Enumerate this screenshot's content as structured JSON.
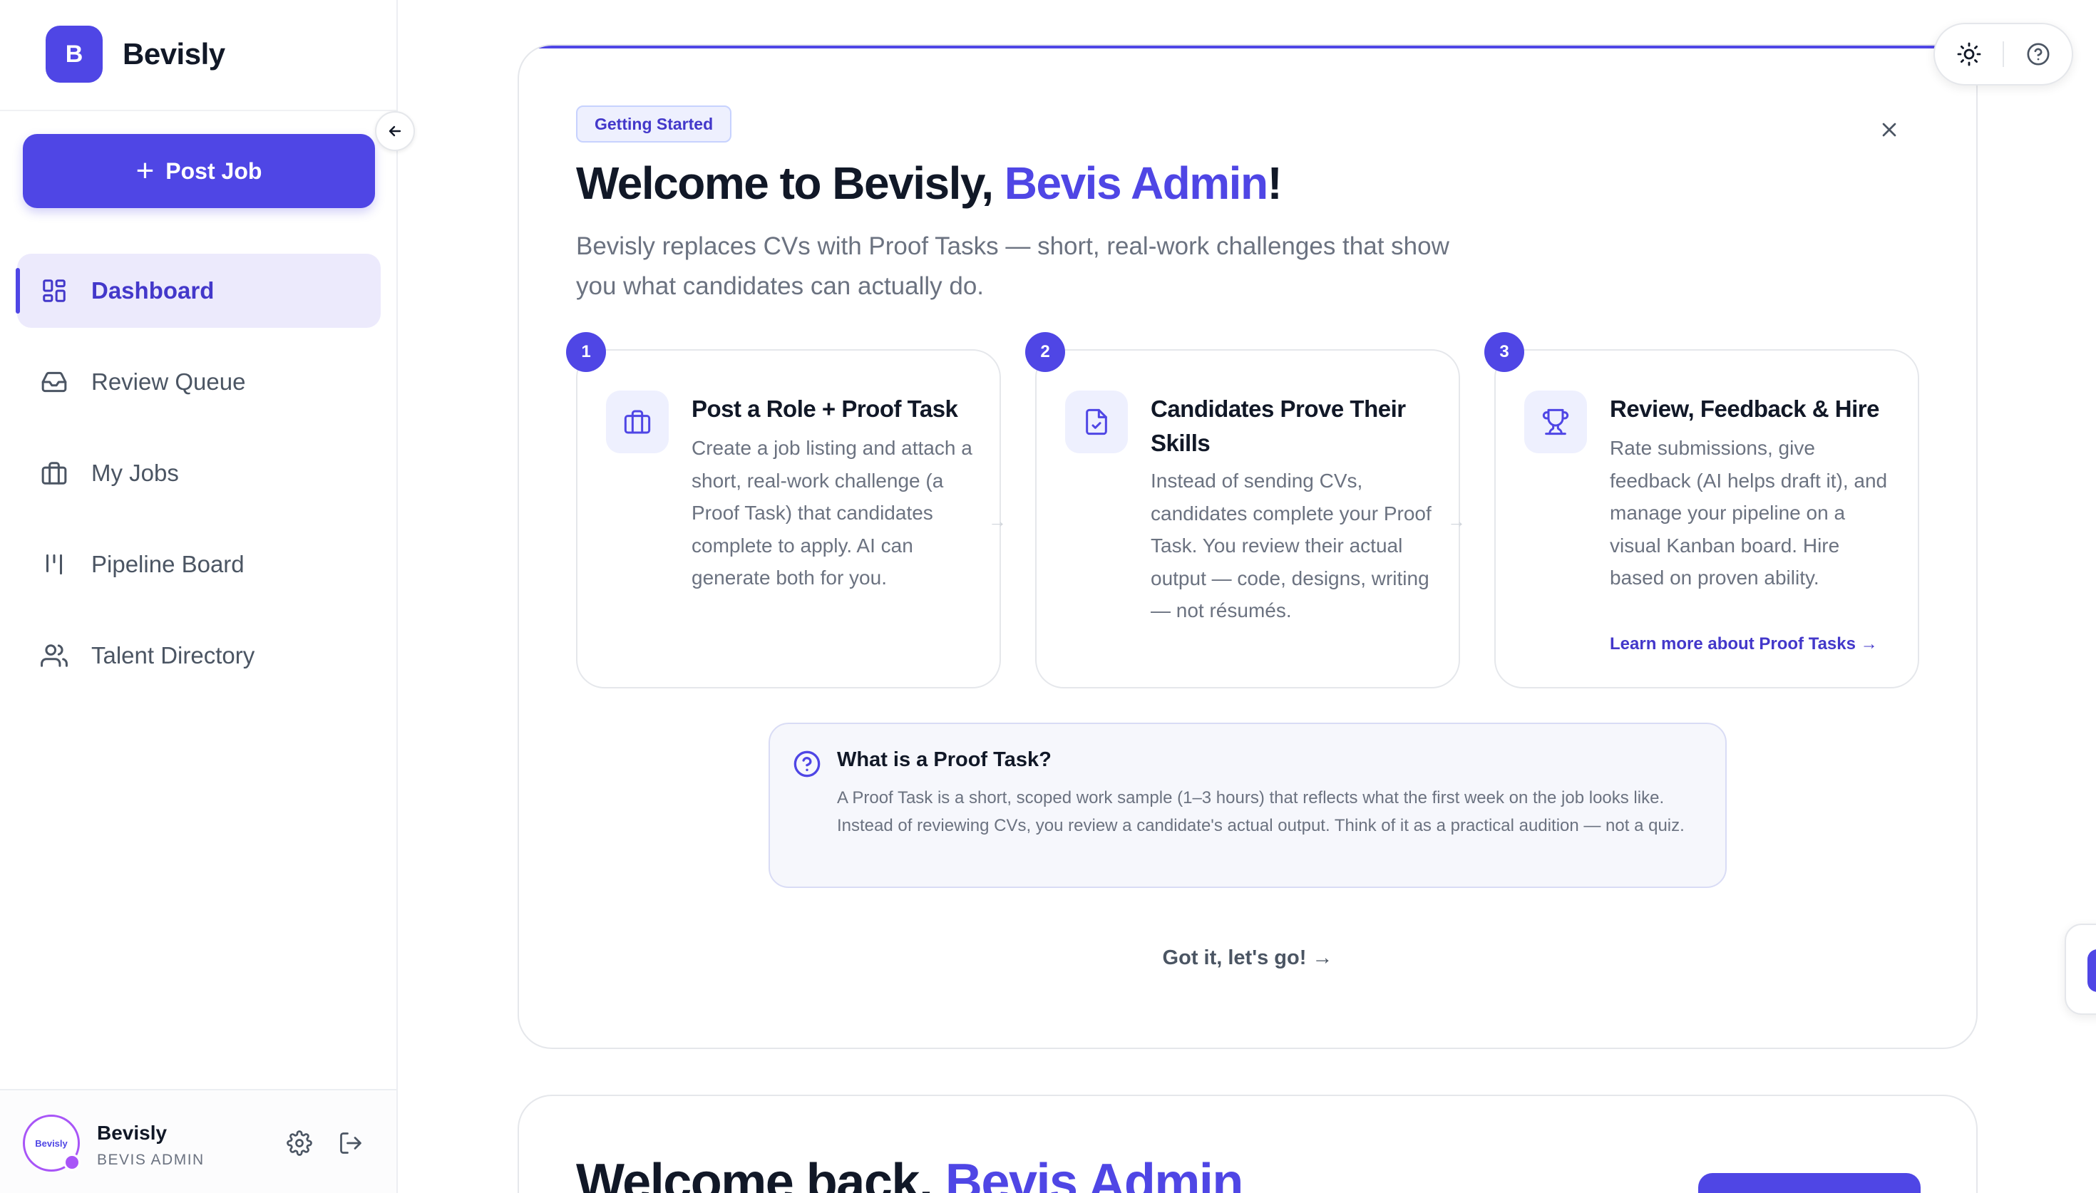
{
  "brand": {
    "logo_letter": "B",
    "name": "Bevisly"
  },
  "sidebar": {
    "post_job_label": "Post Job",
    "items": [
      {
        "label": "Dashboard",
        "icon": "grid-icon",
        "active": true
      },
      {
        "label": "Review Queue",
        "icon": "inbox-icon",
        "active": false
      },
      {
        "label": "My Jobs",
        "icon": "briefcase-icon",
        "active": false
      },
      {
        "label": "Pipeline Board",
        "icon": "kanban-icon",
        "active": false
      },
      {
        "label": "Talent Directory",
        "icon": "users-icon",
        "active": false
      }
    ],
    "user": {
      "name": "Bevisly",
      "role": "BEVIS ADMIN",
      "avatar_text": "Bevisly"
    }
  },
  "welcome": {
    "chip": "Getting Started",
    "title_prefix": "Welcome to Bevisly, ",
    "title_name": "Bevis Admin",
    "title_suffix": "!",
    "subtitle": "Bevisly replaces CVs with Proof Tasks — short, real-work challenges that show you what candidates can actually do.",
    "steps": [
      {
        "num": "1",
        "icon": "briefcase-icon",
        "title": "Post a Role + Proof Task",
        "desc": "Create a job listing and attach a short, real-work challenge (a Proof Task) that candidates complete to apply. AI can generate both for you."
      },
      {
        "num": "2",
        "icon": "file-check-icon",
        "title": "Candidates Prove Their Skills",
        "desc": "Instead of sending CVs, candidates complete your Proof Task. You review their actual output — code, designs, writing — not résumés."
      },
      {
        "num": "3",
        "icon": "trophy-icon",
        "title": "Review, Feedback & Hire",
        "desc": "Rate submissions, give feedback (AI helps draft it), and manage your pipeline on a visual Kanban board. Hire based on proven ability.",
        "link": "Learn more about Proof Tasks →"
      }
    ],
    "info": {
      "title": "What is a Proof Task?",
      "body": "A Proof Task is a short, scoped work sample (1–3 hours) that reflects what the first week on the job looks like. Instead of reviewing CVs, you review a candidate's actual output. Think of it as a practical audition — not a quiz."
    },
    "cta": "Got it, let's go! →"
  },
  "back": {
    "title_prefix": "Welcome back, ",
    "title_name": "Bevis Admin"
  },
  "colors": {
    "accent": "#4f46e5",
    "accent_soft": "#eef0fe",
    "text": "#111827",
    "muted": "#6b7280"
  }
}
